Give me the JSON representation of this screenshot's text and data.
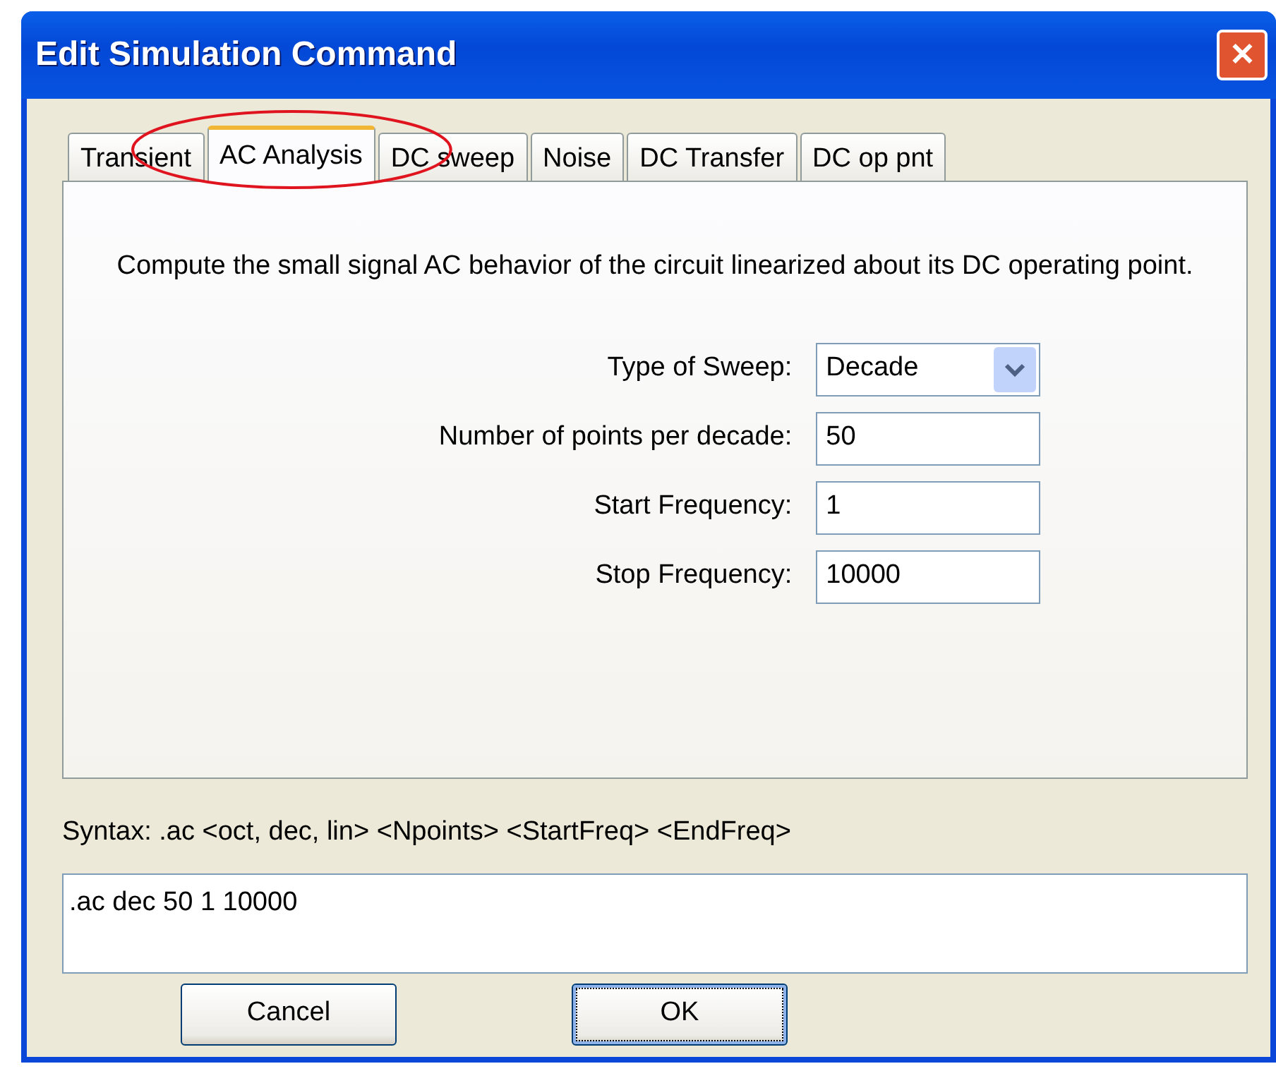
{
  "window": {
    "title": "Edit Simulation Command",
    "close": "✕"
  },
  "tabs": [
    {
      "label": "Transient",
      "selected": false,
      "circled": false
    },
    {
      "label": "AC Analysis",
      "selected": true,
      "circled": true
    },
    {
      "label": "DC sweep",
      "selected": false,
      "circled": false
    },
    {
      "label": "Noise",
      "selected": false,
      "circled": false
    },
    {
      "label": "DC Transfer",
      "selected": false,
      "circled": false
    },
    {
      "label": "DC op pnt",
      "selected": false,
      "circled": false
    }
  ],
  "description": "Compute the small signal AC behavior of the circuit linearized about its DC operating point.",
  "fields": [
    {
      "kind": "dropdown",
      "label": "Type of Sweep:",
      "value": "Decade"
    },
    {
      "kind": "text",
      "label": "Number of points per decade:",
      "value": "50"
    },
    {
      "kind": "text",
      "label": "Start Frequency:",
      "value": "1"
    },
    {
      "kind": "text",
      "label": "Stop Frequency:",
      "value": "10000"
    }
  ],
  "syntax": "Syntax:  .ac <oct, dec, lin> <Npoints> <StartFreq> <EndFreq>",
  "command": ".ac dec 50 1 10000",
  "buttons": [
    {
      "label": "Cancel",
      "focused": false
    },
    {
      "label": "OK",
      "focused": true
    }
  ]
}
